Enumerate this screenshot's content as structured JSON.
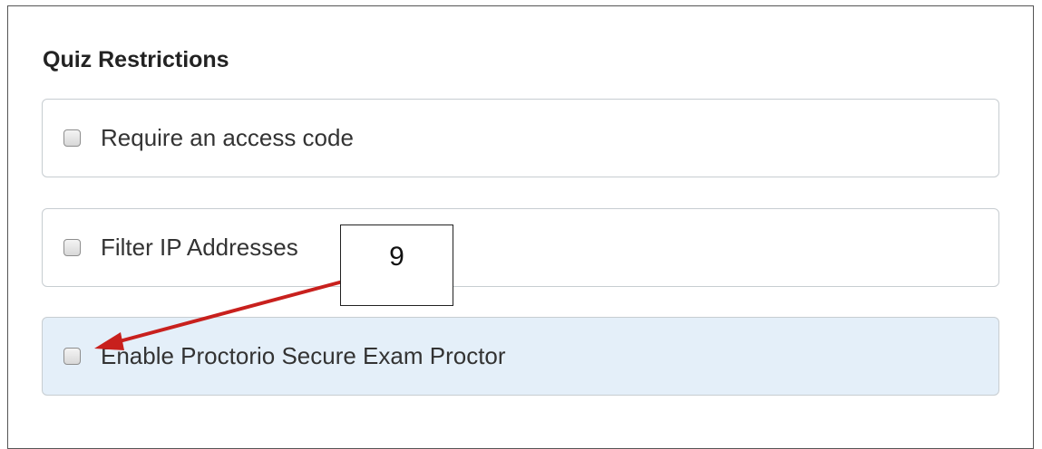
{
  "section": {
    "title": "Quiz Restrictions"
  },
  "options": [
    {
      "label": "Require an access code",
      "checked": false
    },
    {
      "label": "Filter IP Addresses",
      "checked": false
    },
    {
      "label": "Enable Proctorio Secure Exam Proctor",
      "checked": false,
      "highlighted": true
    }
  ],
  "annotation": {
    "step_number": "9",
    "arrow_color": "#c8201d"
  },
  "colors": {
    "highlight_background": "#e4eff9",
    "border": "#c7cdd1"
  }
}
